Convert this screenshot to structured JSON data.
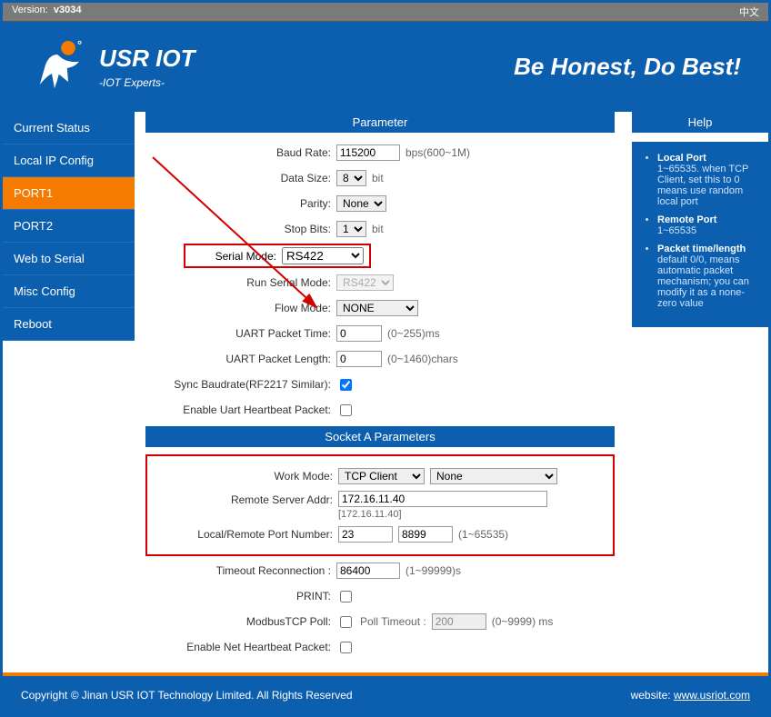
{
  "topbar": {
    "version_label": "Version:",
    "version": "v3034",
    "lang": "中文"
  },
  "header": {
    "brand": "USR IOT",
    "sub": "-IOT Experts-",
    "slogan": "Be Honest, Do Best!"
  },
  "sidebar": {
    "items": [
      {
        "label": "Current Status"
      },
      {
        "label": "Local IP Config"
      },
      {
        "label": "PORT1"
      },
      {
        "label": "PORT2"
      },
      {
        "label": "Web to Serial"
      },
      {
        "label": "Misc Config"
      },
      {
        "label": "Reboot"
      }
    ],
    "active_index": 2
  },
  "param": {
    "title": "Parameter",
    "baud": {
      "label": "Baud Rate:",
      "value": "115200",
      "unit": "bps(600~1M)"
    },
    "data_size": {
      "label": "Data Size:",
      "value": "8",
      "unit": "bit"
    },
    "parity": {
      "label": "Parity:",
      "value": "None"
    },
    "stop_bits": {
      "label": "Stop Bits:",
      "value": "1",
      "unit": "bit"
    },
    "serial_mode": {
      "label": "Serial Mode:",
      "value": "RS422"
    },
    "run_serial_mode": {
      "label": "Run Serial Mode:",
      "value": "RS422"
    },
    "flow_mode": {
      "label": "Flow Mode:",
      "value": "NONE"
    },
    "uart_pkt_time": {
      "label": "UART Packet Time:",
      "value": "0",
      "unit": "(0~255)ms"
    },
    "uart_pkt_len": {
      "label": "UART Packet Length:",
      "value": "0",
      "unit": "(0~1460)chars"
    },
    "sync_baud": {
      "label": "Sync Baudrate(RF2217 Similar):",
      "checked": true
    },
    "uart_hb": {
      "label": "Enable Uart Heartbeat Packet:",
      "checked": false
    }
  },
  "socket": {
    "title": "Socket A Parameters",
    "work_mode": {
      "label": "Work Mode:",
      "value": "TCP Client",
      "value2": "None"
    },
    "remote": {
      "label": "Remote Server Addr:",
      "value": "172.16.11.40",
      "resolved": "[172.16.11.40]"
    },
    "ports": {
      "label": "Local/Remote Port Number:",
      "local": "23",
      "remote": "8899",
      "unit": "(1~65535)"
    },
    "timeout": {
      "label": "Timeout Reconnection :",
      "value": "86400",
      "unit": "(1~99999)s"
    },
    "print": {
      "label": "PRINT:",
      "checked": false
    },
    "modbus": {
      "label": "ModbusTCP Poll:",
      "checked": false,
      "poll_label": "Poll Timeout :",
      "poll_value": "200",
      "poll_unit": "(0~9999) ms"
    },
    "net_hb": {
      "label": "Enable Net Heartbeat Packet:",
      "checked": false
    }
  },
  "help": {
    "title": "Help",
    "items": [
      {
        "term": "Local Port",
        "desc": "1~65535. when TCP Client, set this to 0 means use random local port"
      },
      {
        "term": "Remote Port",
        "desc": "1~65535"
      },
      {
        "term": "Packet time/length",
        "desc": "default 0/0, means automatic packet mechanism; you can modify it as a none-zero value"
      }
    ]
  },
  "footer": {
    "copyright": "Copyright © Jinan USR IOT Technology Limited. All Rights Reserved",
    "site_label": "website:",
    "site_url": "www.usriot.com"
  }
}
